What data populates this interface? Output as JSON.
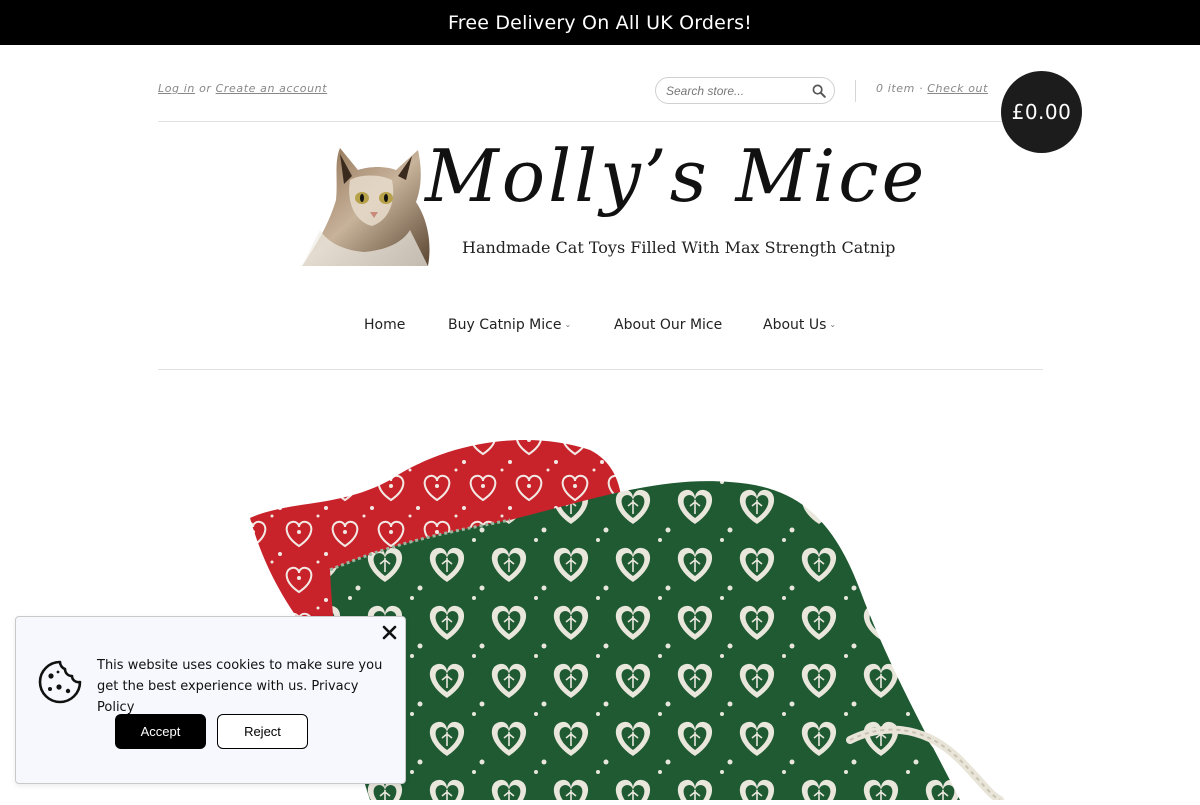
{
  "announcement": {
    "text": "Free Delivery On All UK Orders!"
  },
  "account": {
    "login_label": "Log in",
    "separator": "or",
    "create_label": "Create an account"
  },
  "search": {
    "placeholder": "Search store...",
    "icon": "search-icon"
  },
  "cart": {
    "count_label": "0 item",
    "dot": "·",
    "checkout_label": "Check out",
    "total": "£0.00"
  },
  "logo": {
    "title": "Molly’s Mice",
    "tagline": "Handmade Cat Toys Filled With Max Strength Catnip",
    "image": "cat-photo"
  },
  "nav": {
    "items": [
      {
        "label": "Home",
        "has_dropdown": false
      },
      {
        "label": "Buy Catnip Mice",
        "has_dropdown": true
      },
      {
        "label": "About Our Mice",
        "has_dropdown": false
      },
      {
        "label": "About Us",
        "has_dropdown": true
      }
    ]
  },
  "hero": {
    "image": "catnip-mice-red-and-green-heart-fabric"
  },
  "cookie_banner": {
    "message": "This website uses cookies to make sure you get the best experience with us.",
    "policy_link": "Privacy Policy",
    "accept_label": "Accept",
    "reject_label": "Reject",
    "icon": "cookie-icon",
    "close_icon": "close-icon"
  },
  "colors": {
    "bar": "#000000",
    "text": "#222222",
    "muted": "#888888",
    "bubble": "#1c1c1c",
    "red_fabric": "#c8232b",
    "green_fabric": "#1f5a33"
  }
}
